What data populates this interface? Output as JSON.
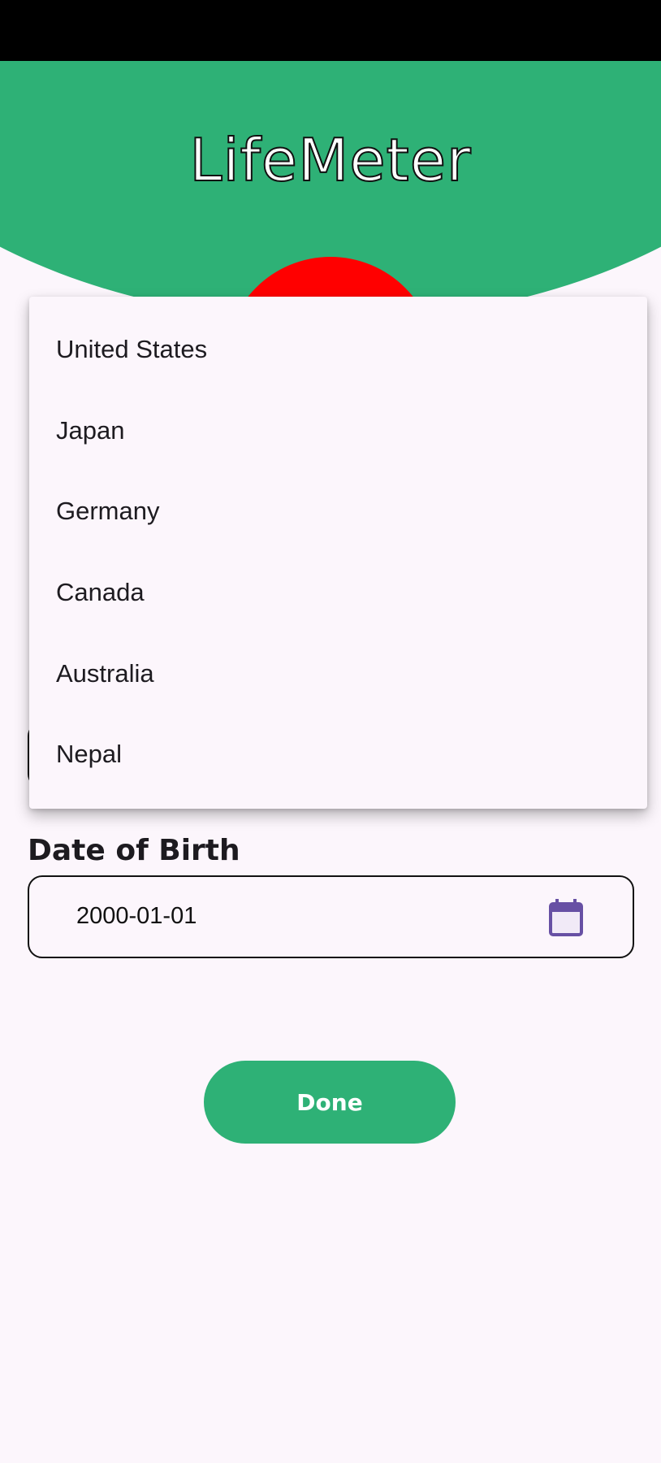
{
  "app": {
    "title": "LifeMeter"
  },
  "colors": {
    "brand_green": "#2eb176",
    "accent_red": "#ff0000",
    "icon_purple": "#6750a4"
  },
  "country_menu": {
    "options": [
      "United States",
      "Japan",
      "Germany",
      "Canada",
      "Australia",
      "Nepal"
    ]
  },
  "dob": {
    "label": "Date of Birth",
    "value": "2000-01-01",
    "icon": "calendar-icon"
  },
  "actions": {
    "done_label": "Done"
  }
}
